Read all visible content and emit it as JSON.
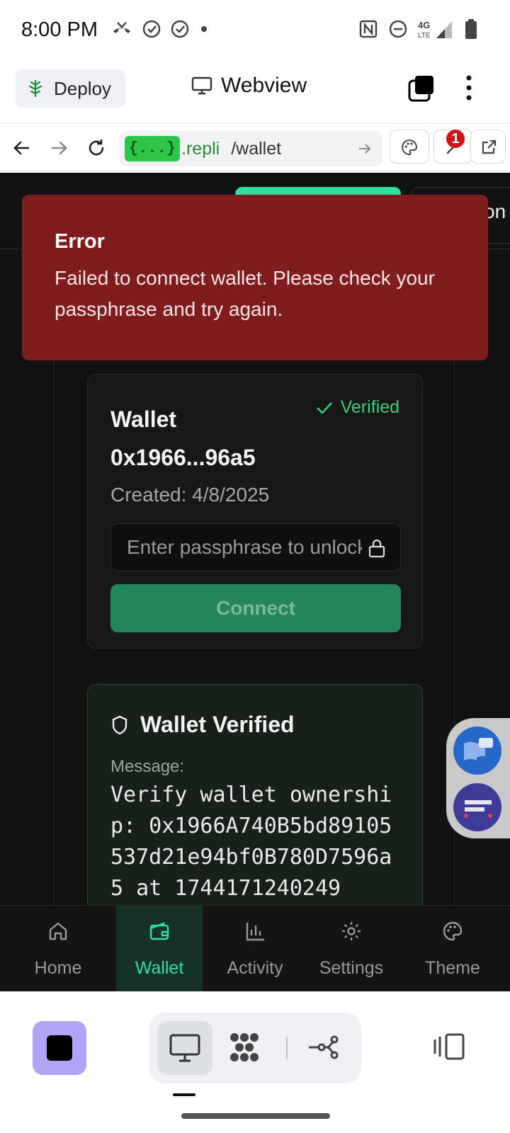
{
  "status_bar": {
    "time": "8:00 PM",
    "network": "4G LTE"
  },
  "replit": {
    "deploy_label": "Deploy",
    "webview_title": "Webview",
    "url": {
      "chip": "{...}",
      "domain": ".repli",
      "path": "/wallet"
    },
    "notification_count": "1"
  },
  "app": {
    "header_pill_partial": "on",
    "toast": {
      "title": "Error",
      "message": "Failed to connect wallet. Please check your passphrase and try again."
    },
    "wallet_card": {
      "title": "Wallet 0x1966...96a5",
      "verified_label": "Verified",
      "created": "Created: 4/8/2025",
      "passphrase_placeholder": "Enter passphrase to unlock",
      "connect_label": "Connect"
    },
    "verified_card": {
      "title": "Wallet Verified",
      "message_label": "Message:",
      "message": "Verify wallet ownership: 0x1966A740B5bd89105537d21e94bf0B780D7596a5 at 1744171240249"
    },
    "bottom_nav": [
      {
        "label": "Home",
        "icon": "home-icon"
      },
      {
        "label": "Wallet",
        "icon": "wallet-icon",
        "active": true
      },
      {
        "label": "Activity",
        "icon": "activity-icon"
      },
      {
        "label": "Settings",
        "icon": "gear-icon"
      },
      {
        "label": "Theme",
        "icon": "palette-icon"
      }
    ]
  },
  "colors": {
    "toast_bg": "#7f1d1d",
    "accent": "#2fe0a0",
    "verified": "#34d17a",
    "connect_bg": "#23855a"
  }
}
